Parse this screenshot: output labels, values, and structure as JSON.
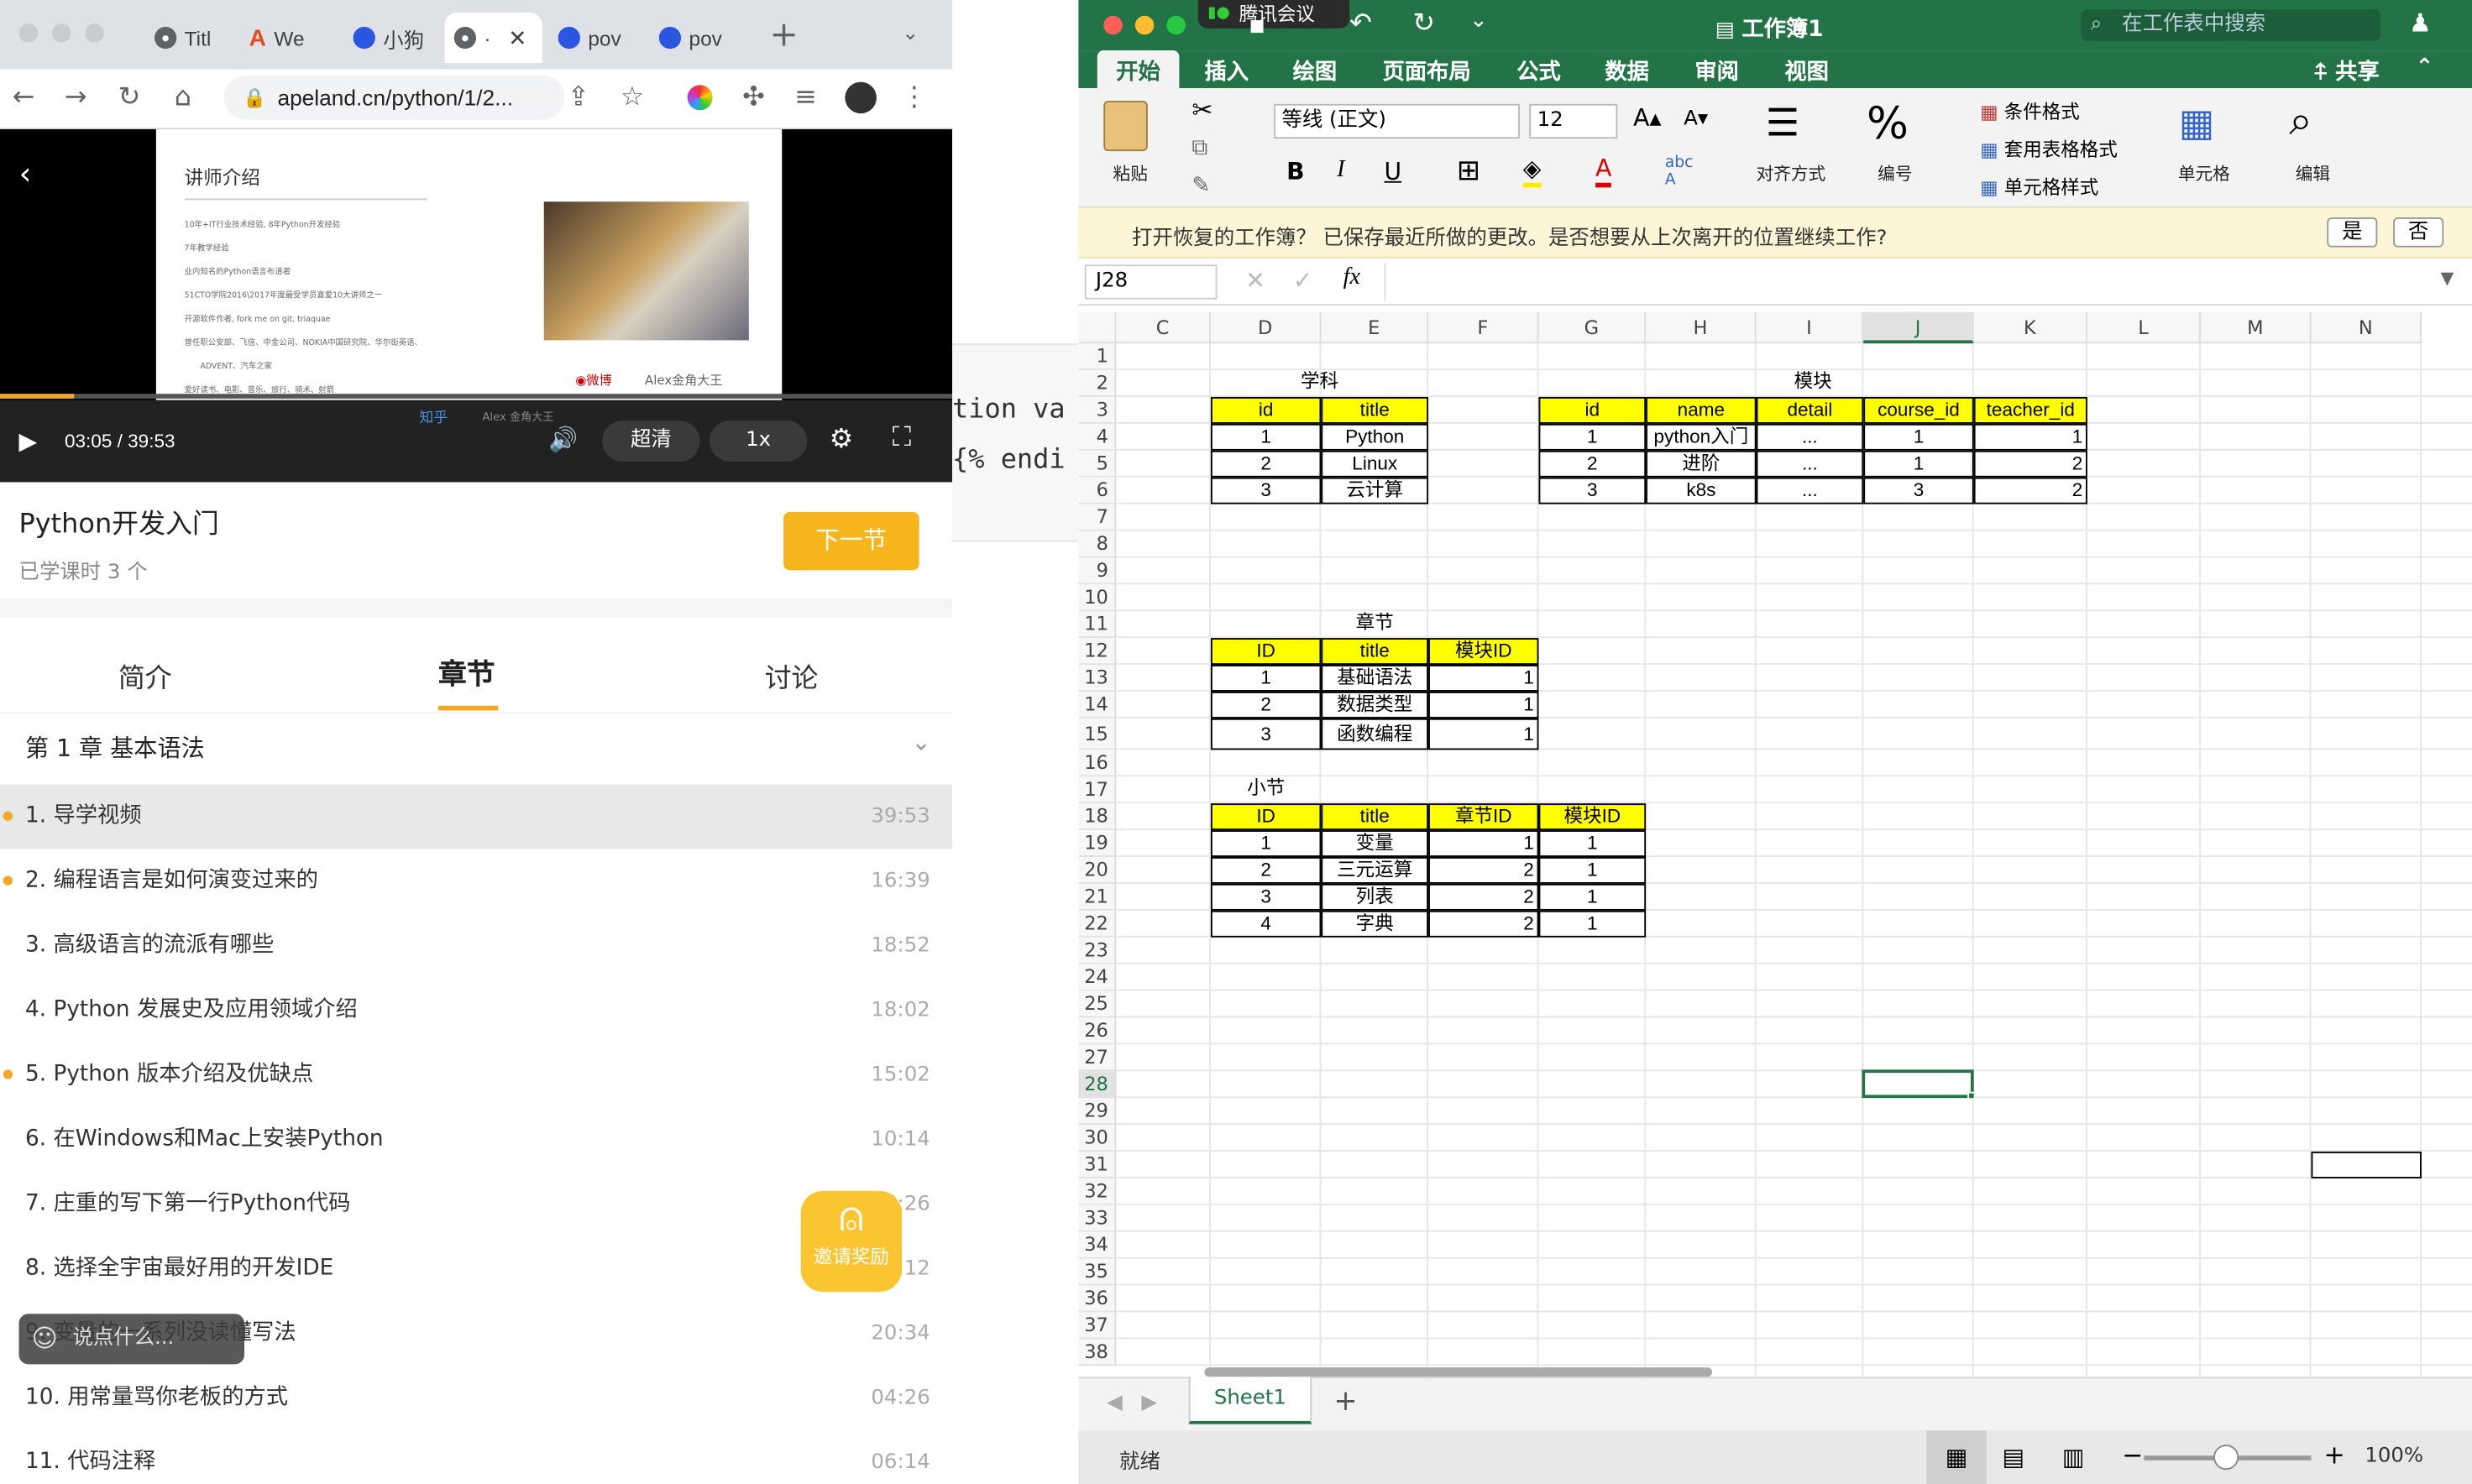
{
  "browser": {
    "tabs": [
      "Titl",
      "We",
      "小狗",
      "·",
      "pov",
      "pov"
    ],
    "url": "apeland.cn/python/1/2...",
    "video": {
      "time": "03:05 / 39:53",
      "quality": "超清",
      "speed": "1x",
      "progress": 0.077,
      "slide_title": "讲师介绍",
      "slide_lines": [
        "10年+IT行业技术经验, 8年Python开发经验",
        "7年教学经验",
        "业内知名的Python语言布道者",
        "51CTO学院2016\\2017年度最受学员喜爱10大讲师之一",
        "开源软件作者, fork me on git, triaquae",
        "曾任职公安部、飞信、中金公司、NOKIA中国研究院、华尔街英语、",
        "ADVENT、汽车之家",
        "爱好读书、电影、音乐、旅行、骑术、射箭"
      ],
      "weibo_label": "微博",
      "weibo_name": "Alex金角大王",
      "zhihu_label": "知乎",
      "zhihu_name": "Alex 金角大王"
    },
    "course_title": "Python开发入门",
    "learned": "已学课时 3 个",
    "next_btn": "下一节",
    "tabs2": [
      "简介",
      "章节",
      "讨论"
    ],
    "chapter": "第 1 章  基本语法",
    "lessons": [
      {
        "name": "1. 导学视频",
        "dur": "39:53",
        "dot": true
      },
      {
        "name": "2. 编程语言是如何演变过来的",
        "dur": "16:39",
        "dot": true
      },
      {
        "name": "3. 高级语言的流派有哪些",
        "dur": "18:52",
        "dot": false
      },
      {
        "name": "4. Python 发展史及应用领域介绍",
        "dur": "18:02",
        "dot": false
      },
      {
        "name": "5. Python 版本介绍及优缺点",
        "dur": "15:02",
        "dot": true
      },
      {
        "name": "6. 在Windows和Mac上安装Python",
        "dur": "10:14",
        "dot": false
      },
      {
        "name": "7. 庄重的写下第一行Python代码",
        "dur": "15:26",
        "dot": false
      },
      {
        "name": "8. 选择全宇宙最好用的开发IDE",
        "dur": "11:12",
        "dot": false
      },
      {
        "name": "9. 变量的一系列没读懂写法",
        "dur": "20:34",
        "dot": false
      },
      {
        "name": "10. 用常量骂你老板的方式",
        "dur": "04:26",
        "dot": false
      },
      {
        "name": "11. 代码注释",
        "dur": "06:14",
        "dot": false
      }
    ],
    "invite": "邀请奖励",
    "chat_placeholder": "说点什么..."
  },
  "desktop": {
    "code1": "tion va",
    "code2": "{% endi"
  },
  "excel": {
    "meeting": "腾讯会议",
    "title": "工作簿1",
    "search": "在工作表中搜索",
    "tabs": [
      "开始",
      "插入",
      "绘图",
      "页面布局",
      "公式",
      "数据",
      "审阅",
      "视图"
    ],
    "share": "共享",
    "paste": "粘贴",
    "font": "等线 (正文)",
    "size": "12",
    "align": "对齐方式",
    "number": "编号",
    "cond": "条件格式",
    "table_fmt": "套用表格格式",
    "cell_style": "单元格样式",
    "cells": "单元格",
    "edit": "编辑",
    "recovery": "打开恢复的工作簿？ 已保存最近所做的更改。是否想要从上次离开的位置继续工作?",
    "yes": "是",
    "no": "否",
    "namebox": "J28",
    "columns": [
      "C",
      "D",
      "E",
      "F",
      "G",
      "H",
      "I",
      "J",
      "K",
      "L",
      "M",
      "N"
    ],
    "rows": [
      "1",
      "2",
      "3",
      "4",
      "5",
      "6",
      "7",
      "8",
      "9",
      "10",
      "11",
      "12",
      "13",
      "14",
      "15",
      "16",
      "17",
      "18",
      "19",
      "20",
      "21",
      "22",
      "23",
      "24",
      "25",
      "26",
      "27",
      "28",
      "29",
      "30",
      "31",
      "32",
      "33",
      "34",
      "35",
      "36",
      "37",
      "38"
    ],
    "t1": {
      "title": "学科",
      "head": [
        "id",
        "title"
      ],
      "rows": [
        [
          "1",
          "Python"
        ],
        [
          "2",
          "Linux"
        ],
        [
          "3",
          "云计算"
        ]
      ]
    },
    "t2": {
      "title": "模块",
      "head": [
        "id",
        "name",
        "detail",
        "course_id",
        "teacher_id"
      ],
      "rows": [
        [
          "1",
          "python入门",
          "...",
          "1",
          "1"
        ],
        [
          "2",
          "进阶",
          "...",
          "1",
          "2"
        ],
        [
          "3",
          "k8s",
          "...",
          "3",
          "2"
        ]
      ]
    },
    "t3": {
      "title": "章节",
      "head": [
        "ID",
        "title",
        "模块ID"
      ],
      "rows": [
        [
          "1",
          "基础语法",
          "1"
        ],
        [
          "2",
          "数据类型",
          "1"
        ],
        [
          "3",
          "函数编程",
          "1"
        ]
      ]
    },
    "t4": {
      "title": "小节",
      "head": [
        "ID",
        "title",
        "章节ID",
        "模块ID"
      ],
      "rows": [
        [
          "1",
          "变量",
          "1",
          "1"
        ],
        [
          "2",
          "三元运算",
          "2",
          "1"
        ],
        [
          "3",
          "列表",
          "2",
          "1"
        ],
        [
          "4",
          "字典",
          "2",
          "1"
        ]
      ]
    },
    "sheet": "Sheet1",
    "status": "就绪",
    "zoom": "100%"
  }
}
